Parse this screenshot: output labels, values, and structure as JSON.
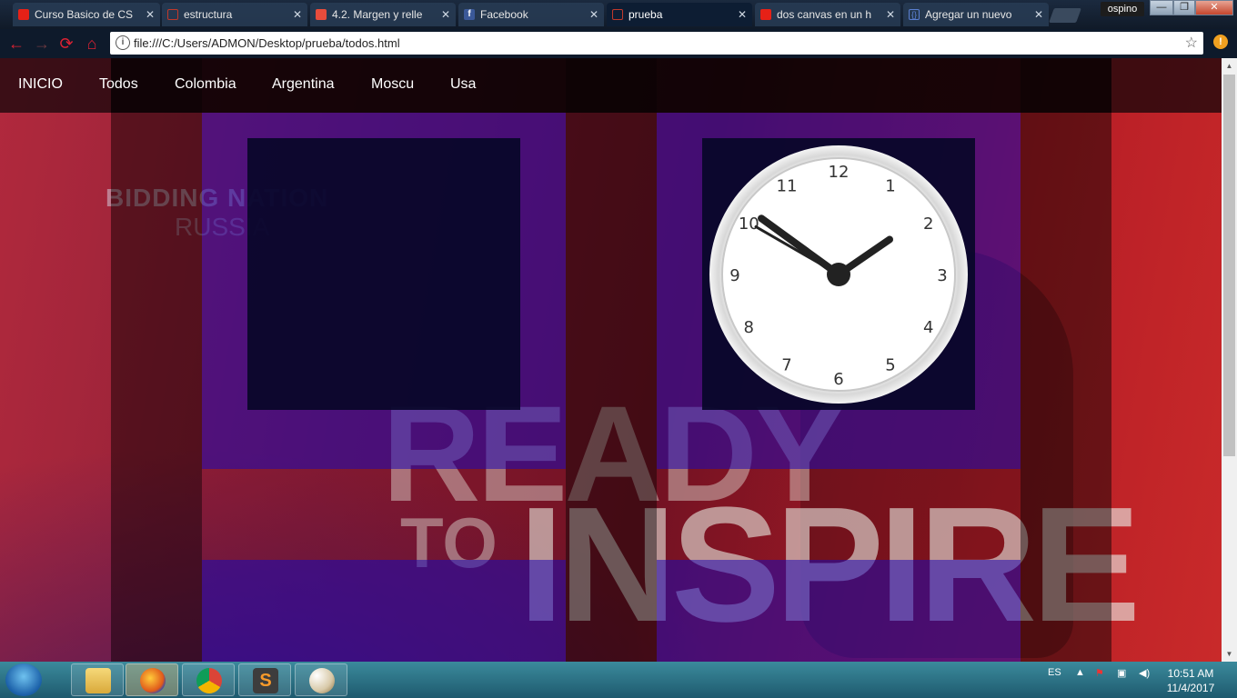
{
  "browser": {
    "tabs": [
      {
        "label": "Curso Basico de CS",
        "icon": "youtube-icon",
        "color": "#e62117"
      },
      {
        "label": "estructura",
        "icon": "file-icon",
        "color": "#c0392b"
      },
      {
        "label": "4.2. Margen y relle",
        "icon": "book-icon",
        "color": "#e74c3c"
      },
      {
        "label": "Facebook",
        "icon": "facebook-icon",
        "color": "#3b5998"
      },
      {
        "label": "prueba",
        "icon": "file-icon",
        "color": "#c0392b"
      },
      {
        "label": "dos canvas en un h",
        "icon": "youtube-icon",
        "color": "#e62117"
      },
      {
        "label": "Agregar un nuevo",
        "icon": "code-icon",
        "color": "#5a7fd0"
      }
    ],
    "user": "ospino",
    "url": "file:///C:/Users/ADMON/Desktop/prueba/todos.html",
    "win_minimize": "—",
    "win_restore": "❐",
    "win_close": "✕",
    "back": "←",
    "forward": "→",
    "reload": "⟳",
    "home": "⌂",
    "info": "i",
    "star": "☆",
    "menu_badge": "!"
  },
  "nav": {
    "items": [
      "INICIO",
      "Todos",
      "Colombia",
      "Argentina",
      "Moscu",
      "Usa"
    ]
  },
  "background": {
    "line1": "BIDDING NATION",
    "line2": "RUSSIA",
    "line3": "READY",
    "line4": "TO",
    "line5": "INSPIRE"
  },
  "clock": {
    "numbers": [
      "12",
      "1",
      "2",
      "3",
      "4",
      "5",
      "6",
      "7",
      "8",
      "9",
      "10",
      "11"
    ],
    "hour": 1,
    "minute": 51,
    "second": 50
  },
  "taskbar": {
    "language": "ES",
    "time": "10:51 AM",
    "date": "11/4/2017",
    "apps": [
      "explorer-icon",
      "firefox-icon",
      "chrome-icon",
      "sublime-icon",
      "paint-icon"
    ]
  }
}
